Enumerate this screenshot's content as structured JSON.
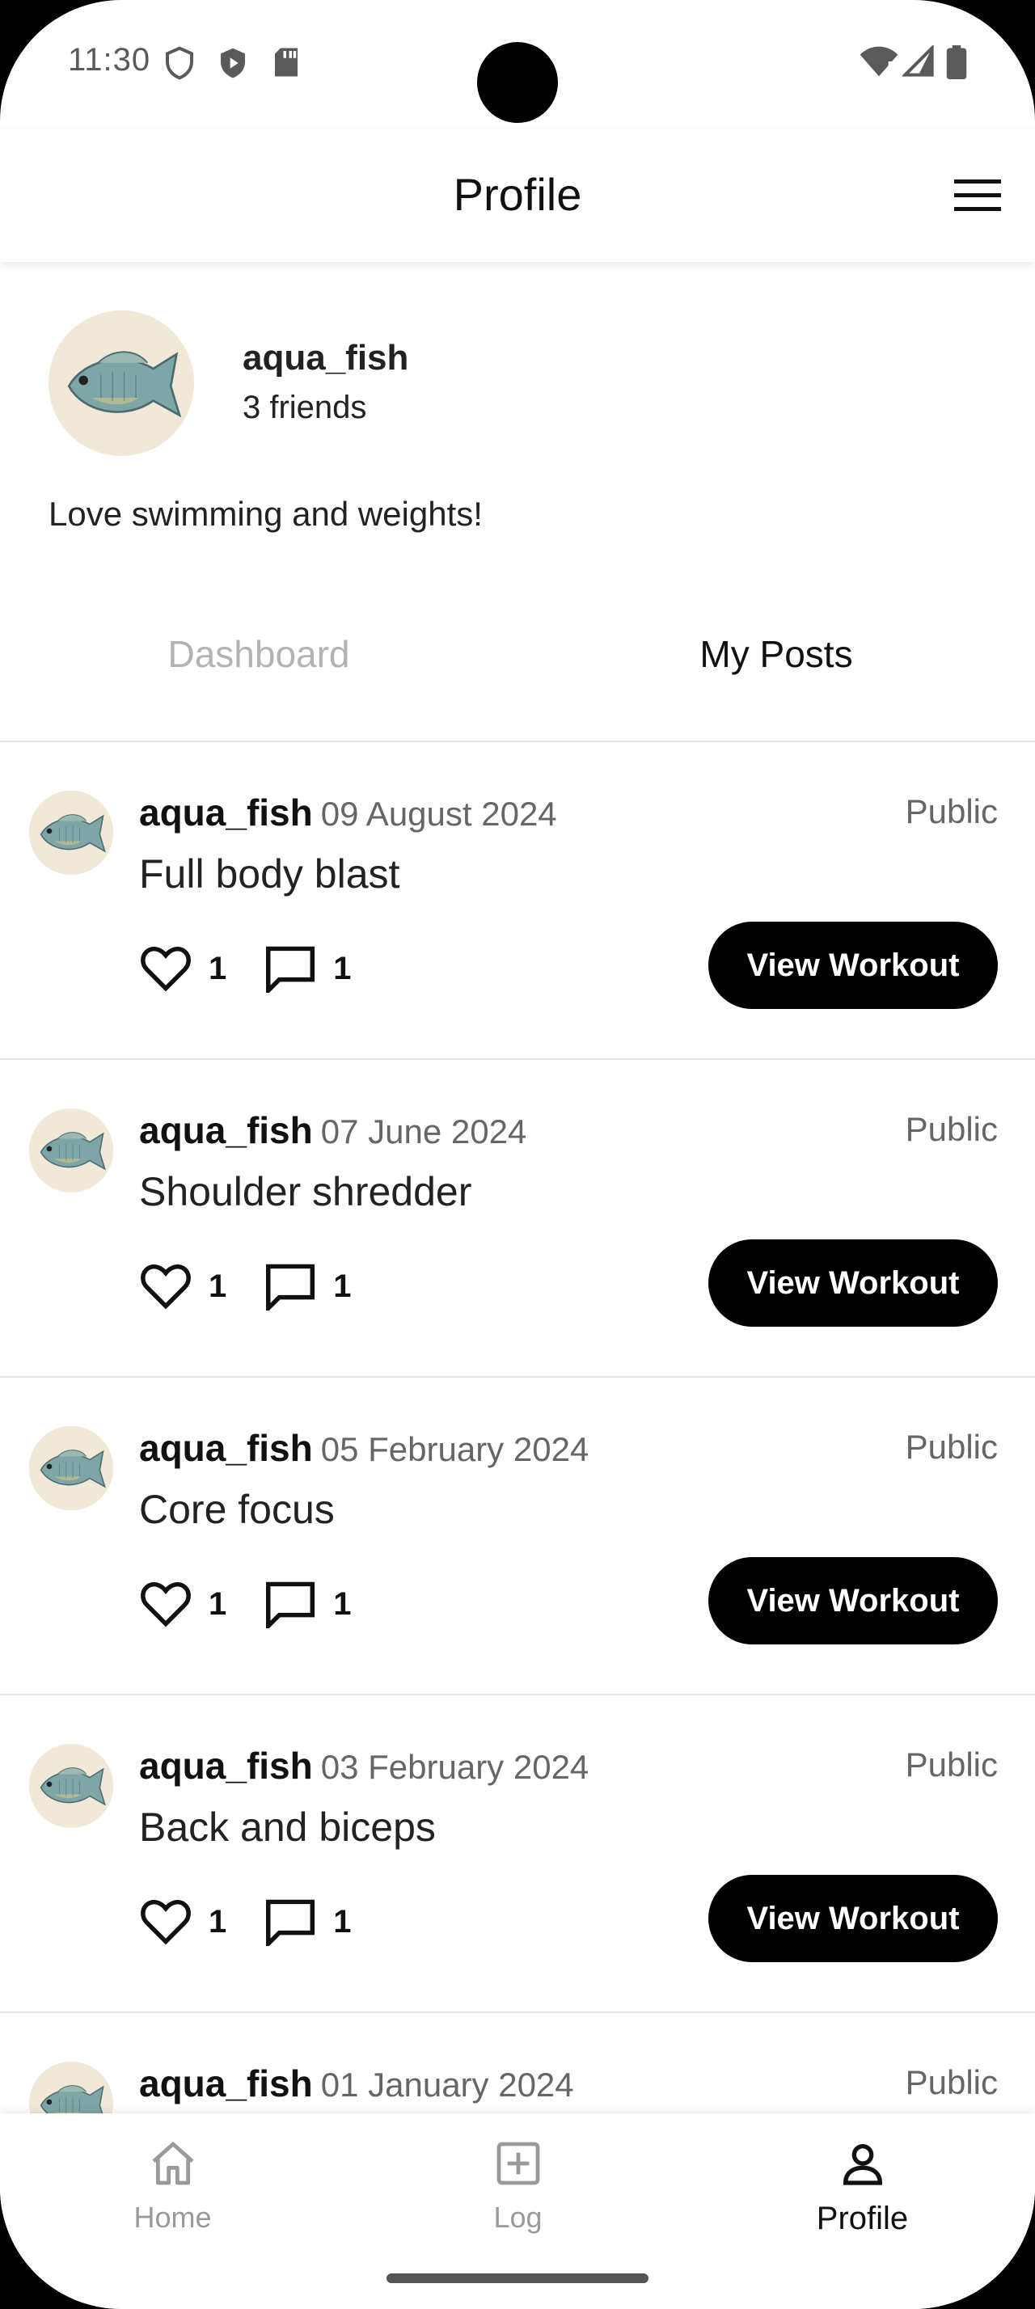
{
  "status_bar": {
    "time": "11:30"
  },
  "app_bar": {
    "title": "Profile"
  },
  "profile": {
    "username": "aqua_fish",
    "friends": "3 friends",
    "bio": "Love swimming and weights!"
  },
  "tabs": [
    {
      "label": "Dashboard",
      "active": false
    },
    {
      "label": "My Posts",
      "active": true
    }
  ],
  "posts": [
    {
      "user": "aqua_fish",
      "date": "09 August 2024",
      "visibility": "Public",
      "title": "Full body blast",
      "likes": "1",
      "comments": "1",
      "button": "View Workout"
    },
    {
      "user": "aqua_fish",
      "date": "07 June 2024",
      "visibility": "Public",
      "title": "Shoulder shredder",
      "likes": "1",
      "comments": "1",
      "button": "View Workout"
    },
    {
      "user": "aqua_fish",
      "date": "05 February 2024",
      "visibility": "Public",
      "title": "Core focus",
      "likes": "1",
      "comments": "1",
      "button": "View Workout"
    },
    {
      "user": "aqua_fish",
      "date": "03 February 2024",
      "visibility": "Public",
      "title": "Back and biceps",
      "likes": "1",
      "comments": "1",
      "button": "View Workout"
    },
    {
      "user": "aqua_fish",
      "date": "01 January 2024",
      "visibility": "Public"
    }
  ],
  "bottom_nav": [
    {
      "label": "Home",
      "icon": "home-icon",
      "active": false
    },
    {
      "label": "Log",
      "icon": "plus-square-icon",
      "active": false
    },
    {
      "label": "Profile",
      "icon": "person-icon",
      "active": true
    }
  ],
  "colors": {
    "accent": "#000000",
    "avatar_bg": "#f1e8d8",
    "fish": "#6f9aa0"
  }
}
